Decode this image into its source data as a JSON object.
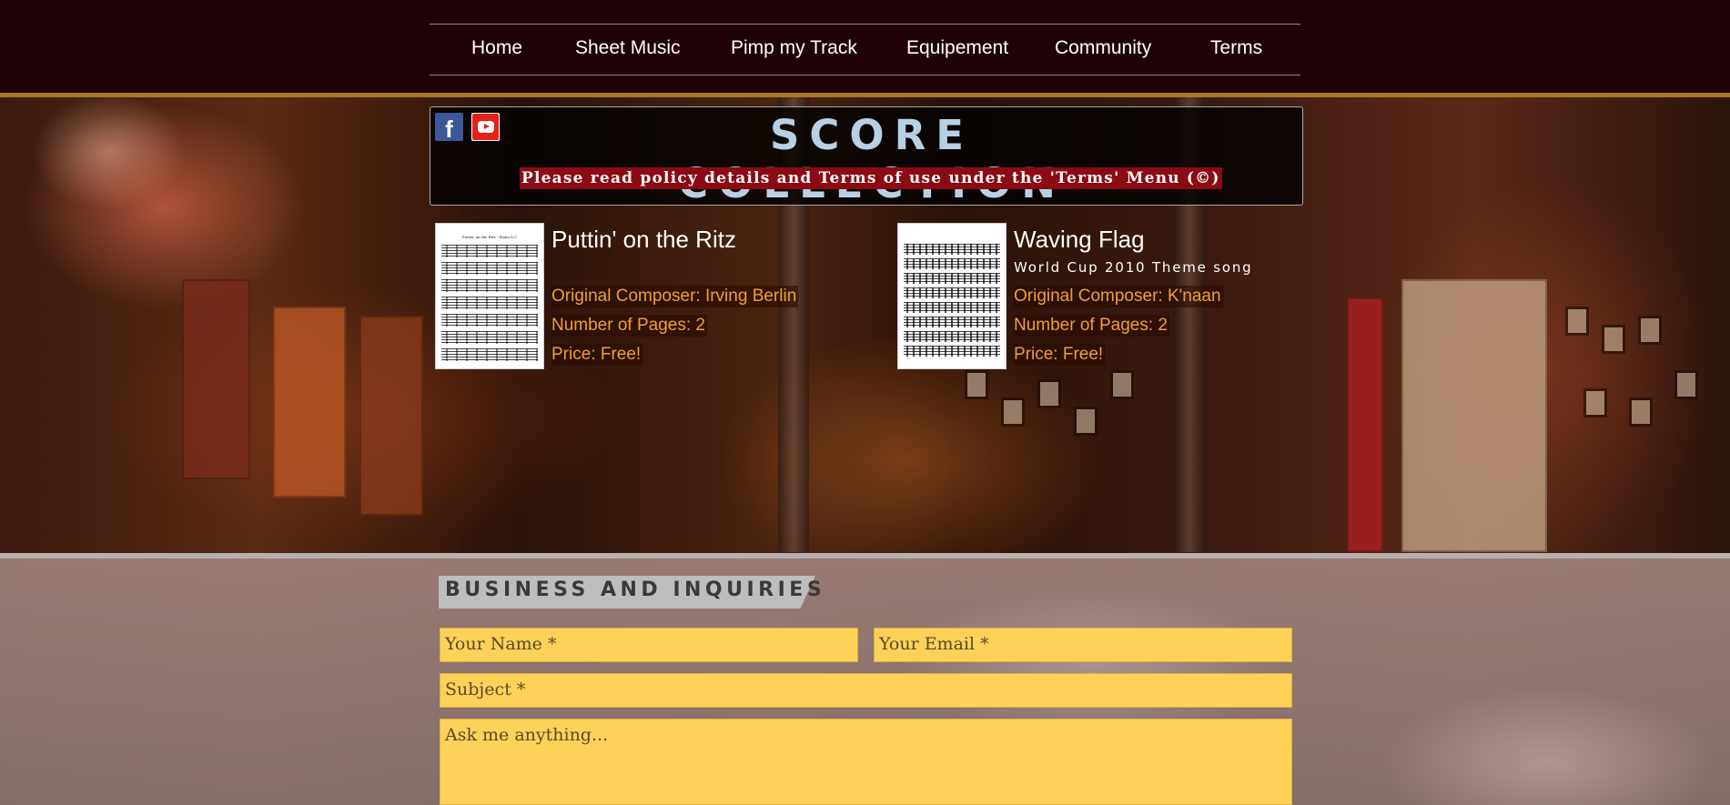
{
  "nav": {
    "items": [
      {
        "label": "Home"
      },
      {
        "label": "Sheet Music"
      },
      {
        "label": "Pimp my Track"
      },
      {
        "label": "Equipement"
      },
      {
        "label": "Community"
      },
      {
        "label": "Terms"
      }
    ]
  },
  "header": {
    "title": "SCORE COLLECTION",
    "policy": "Please read policy details and Terms of use under the 'Terms' Menu (©)",
    "social": [
      "facebook-icon",
      "youtube-icon"
    ]
  },
  "scores": [
    {
      "name": "Puttin' on the Ritz",
      "subtitle": "",
      "thumb_title": "Puttin' on the Ritz - Piano S.C",
      "composer": "Original Composer: Irving Berlin",
      "pages": "Number of Pages: 2",
      "price": "Price: Free!"
    },
    {
      "name": "Waving Flag",
      "subtitle": "World Cup 2010 Theme song",
      "thumb_title": "",
      "composer": "Original Composer: K'naan",
      "pages": "Number of Pages: 2",
      "price": "Price: Free!"
    }
  ],
  "business": {
    "heading": "BUSINESS AND INQUIRIES",
    "name_placeholder": "Your Name *",
    "email_placeholder": "Your Email *",
    "subject_placeholder": "Subject *",
    "message_placeholder": "Ask me anything..."
  },
  "colors": {
    "header_bg": "#1f0206",
    "accent_gold": "#a8782a",
    "title_blue": "#b8d0e4",
    "policy_red": "#8c0a12",
    "detail_orange": "#f0a030",
    "field_yellow": "#fed158"
  }
}
